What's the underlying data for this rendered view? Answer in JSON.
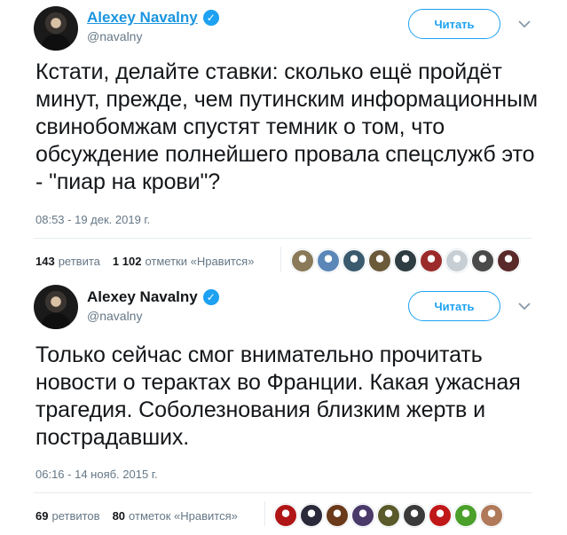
{
  "tweets": [
    {
      "author_name": "Alexey Navalny",
      "handle": "@navalny",
      "follow_label": "Читать",
      "text": "Кстати, делайте ставки: сколько ещё пройдёт минут, прежде, чем путинским информационным свинобомжам спустят темник о том, что обсуждение полнейшего провала спецслужб это - \"пиар на крови\"?",
      "timestamp": "08:53 - 19 дек. 2019 г.",
      "retweet_count": "143",
      "retweet_label": "ретвита",
      "like_count": "1 102",
      "like_label": "отметки «Нравится»",
      "faces": [
        "#8a7a5a",
        "#5b87b8",
        "#3a5a6e",
        "#6b5a3a",
        "#2e3d42",
        "#9b2b2b",
        "#c7ced4",
        "#4a4a4a",
        "#5a2a2a"
      ]
    },
    {
      "author_name": "Alexey Navalny",
      "handle": "@navalny",
      "follow_label": "Читать",
      "text": "Только сейчас смог внимательно прочитать новости о терактах во Франции. Какая ужасная трагедия. Соболезнования близким жертв и пострадавших.",
      "timestamp": "06:16 - 14 нояб. 2015 г.",
      "retweet_count": "69",
      "retweet_label": "ретвитов",
      "like_count": "80",
      "like_label": "отметок «Нравится»",
      "faces": [
        "#b01616",
        "#2a2a3a",
        "#6a3a1a",
        "#4a3a6a",
        "#5a5a2a",
        "#3a3a3a",
        "#c01818",
        "#4aa02a",
        "#b07a5a"
      ]
    }
  ],
  "colors": {
    "accent": "#1da1f2",
    "link": "#1b95e0",
    "muted": "#657786",
    "text": "#14171a",
    "divider": "#e6ecf0"
  },
  "icons": [
    "avatar",
    "verified-badge-icon",
    "chevron-down-icon"
  ]
}
